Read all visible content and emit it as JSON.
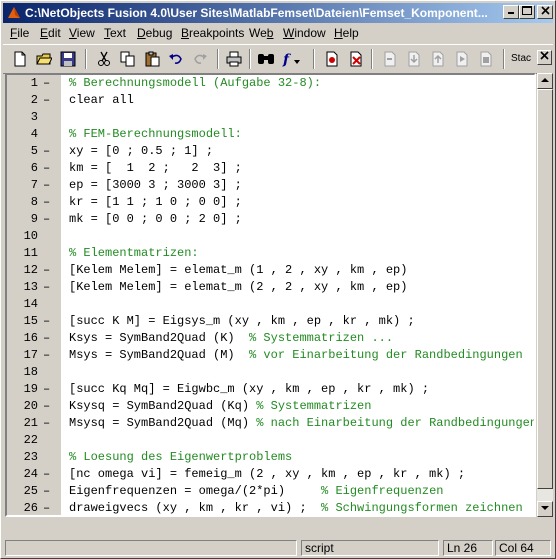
{
  "window": {
    "title": "C:\\NetObjects Fusion 4.0\\User Sites\\MatlabFemset\\Dateien\\Femset_Komponent..."
  },
  "menu": [
    {
      "key": "file",
      "pre": "",
      "u": "F",
      "post": "ile"
    },
    {
      "key": "edit",
      "pre": "",
      "u": "E",
      "post": "dit"
    },
    {
      "key": "view",
      "pre": "",
      "u": "V",
      "post": "iew"
    },
    {
      "key": "text",
      "pre": "",
      "u": "T",
      "post": "ext"
    },
    {
      "key": "debug",
      "pre": "",
      "u": "D",
      "post": "ebug"
    },
    {
      "key": "breakpoints",
      "pre": "",
      "u": "B",
      "post": "reakpoints"
    },
    {
      "key": "web",
      "pre": "We",
      "u": "b",
      "post": ""
    },
    {
      "key": "window",
      "pre": "",
      "u": "W",
      "post": "indow"
    },
    {
      "key": "help",
      "pre": "",
      "u": "H",
      "post": "elp"
    }
  ],
  "toolbar": {
    "stack_label": "Stac"
  },
  "editor": {
    "lines": [
      {
        "n": "1",
        "dash": true,
        "code": "",
        "comment": "% Berechnungsmodell (Aufgabe 32-8):"
      },
      {
        "n": "2",
        "dash": true,
        "code": "clear all",
        "comment": ""
      },
      {
        "n": "3",
        "dash": false,
        "code": "",
        "comment": ""
      },
      {
        "n": "4",
        "dash": false,
        "code": "",
        "comment": "% FEM-Berechnungsmodell:"
      },
      {
        "n": "5",
        "dash": true,
        "code": "xy = [0 ; 0.5 ; 1] ;",
        "comment": ""
      },
      {
        "n": "6",
        "dash": true,
        "code": "km = [  1  2 ;   2  3] ;",
        "comment": ""
      },
      {
        "n": "7",
        "dash": true,
        "code": "ep = [3000 3 ; 3000 3] ;",
        "comment": ""
      },
      {
        "n": "8",
        "dash": true,
        "code": "kr = [1 1 ; 1 0 ; 0 0] ;",
        "comment": ""
      },
      {
        "n": "9",
        "dash": true,
        "code": "mk = [0 0 ; 0 0 ; 2 0] ;",
        "comment": ""
      },
      {
        "n": "10",
        "dash": false,
        "code": "",
        "comment": ""
      },
      {
        "n": "11",
        "dash": false,
        "code": "",
        "comment": "% Elementmatrizen:"
      },
      {
        "n": "12",
        "dash": true,
        "code": "[Kelem Melem] = elemat_m (1 , 2 , xy , km , ep)",
        "comment": ""
      },
      {
        "n": "13",
        "dash": true,
        "code": "[Kelem Melem] = elemat_m (2 , 2 , xy , km , ep)",
        "comment": ""
      },
      {
        "n": "14",
        "dash": false,
        "code": "",
        "comment": ""
      },
      {
        "n": "15",
        "dash": true,
        "code": "[succ K M] = Eigsys_m (xy , km , ep , kr , mk) ;",
        "comment": ""
      },
      {
        "n": "16",
        "dash": true,
        "code": "Ksys = SymBand2Quad (K)  ",
        "comment": "% Systemmatrizen ..."
      },
      {
        "n": "17",
        "dash": true,
        "code": "Msys = SymBand2Quad (M)  ",
        "comment": "% vor Einarbeitung der Randbedingungen"
      },
      {
        "n": "18",
        "dash": false,
        "code": "",
        "comment": ""
      },
      {
        "n": "19",
        "dash": true,
        "code": "[succ Kq Mq] = Eigwbc_m (xy , km , ep , kr , mk) ;",
        "comment": ""
      },
      {
        "n": "20",
        "dash": true,
        "code": "Ksysq = SymBand2Quad (Kq) ",
        "comment": "% Systemmatrizen"
      },
      {
        "n": "21",
        "dash": true,
        "code": "Msysq = SymBand2Quad (Mq) ",
        "comment": "% nach Einarbeitung der Randbedingungen"
      },
      {
        "n": "22",
        "dash": false,
        "code": "",
        "comment": ""
      },
      {
        "n": "23",
        "dash": false,
        "code": "",
        "comment": "% Loesung des Eigenwertproblems"
      },
      {
        "n": "24",
        "dash": true,
        "code": "[nc omega vi] = femeig_m (2 , xy , km , ep , kr , mk) ;",
        "comment": ""
      },
      {
        "n": "25",
        "dash": true,
        "code": "Eigenfrequenzen = omega/(2*pi)     ",
        "comment": "% Eigenfrequenzen"
      },
      {
        "n": "26",
        "dash": true,
        "code": "draweigvecs (xy , km , kr , vi) ;  ",
        "comment": "% Schwingungsformen zeichnen"
      }
    ]
  },
  "status": {
    "mode": "script",
    "line": "Ln 26",
    "col": "Col 64"
  },
  "colors": {
    "comment": "#228b22",
    "title_start": "#0a246a",
    "title_end": "#a6caf0"
  }
}
